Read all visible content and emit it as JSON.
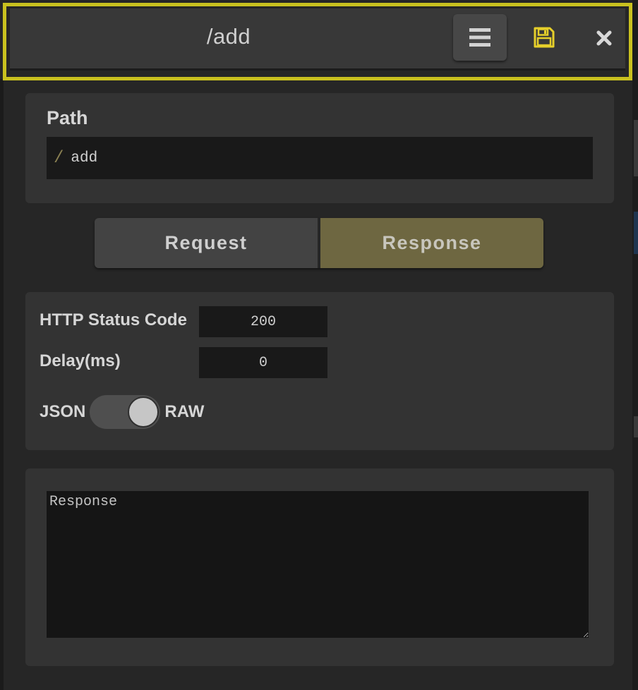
{
  "header": {
    "title": "/add",
    "accent_color": "#c9c11f",
    "save_icon_color": "#e6cf2a",
    "menu_icon": "hamburger-menu-icon",
    "save_icon": "floppy-disk-icon",
    "close_icon": "close-x-icon"
  },
  "path_section": {
    "label": "Path",
    "prefix": "/",
    "value": "add"
  },
  "tabs": [
    {
      "label": "Request",
      "active": false
    },
    {
      "label": "Response",
      "active": true,
      "active_color": "#6e6741"
    }
  ],
  "settings": {
    "status_label": "HTTP Status Code",
    "status_value": "200",
    "delay_label": "Delay(ms)",
    "delay_value": "0",
    "format_left_label": "JSON",
    "format_right_label": "RAW",
    "format_selected": "RAW"
  },
  "response_body": {
    "placeholder": "Response",
    "value": ""
  }
}
